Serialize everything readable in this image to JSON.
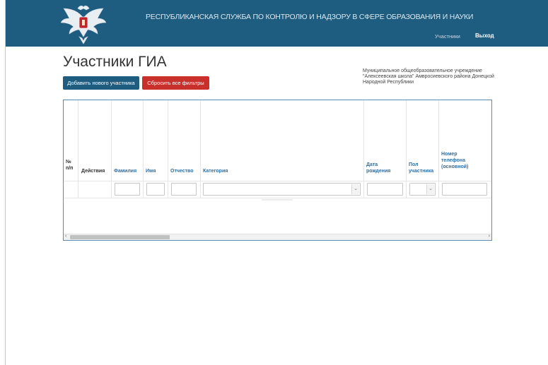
{
  "header": {
    "title": "РЕСПУБЛИКАНСКАЯ СЛУЖБА ПО КОНТРОЛЮ И НАДЗОРУ В СФЕРЕ ОБРАЗОВАНИЯ И НАУКИ",
    "nav": {
      "participants": "Участники",
      "logout": "Выход"
    },
    "colors": {
      "bar": "#1f5d80",
      "logo_red": "#c0262c"
    }
  },
  "page": {
    "title": "Участники ГИА",
    "org_name": "Муниципальное общеобразовательное учреждение \"Алексеевская школа\" Амвросиевского района Донецкой Народной Республики"
  },
  "buttons": {
    "add": "Добавить нового участника",
    "reset": "Сбросить все фильтры"
  },
  "table": {
    "columns": [
      {
        "label": "№ п/п",
        "sortable": false
      },
      {
        "label": "Действия",
        "sortable": false
      },
      {
        "label": "Фамилия",
        "sortable": true
      },
      {
        "label": "Имя",
        "sortable": true
      },
      {
        "label": "Отчество",
        "sortable": true
      },
      {
        "label": "Категория",
        "sortable": true
      },
      {
        "label": "Дата рождения",
        "sortable": true
      },
      {
        "label": "Пол участника",
        "sortable": true
      },
      {
        "label": "Номер телефона (основной)",
        "sortable": true
      }
    ],
    "filters": {
      "surname": "",
      "name": "",
      "patronymic": "",
      "category": "",
      "birth_date": "",
      "gender": "",
      "phone": ""
    },
    "scroll_icons": {
      "left": "chevron-left-icon",
      "right": "chevron-right-icon"
    }
  }
}
